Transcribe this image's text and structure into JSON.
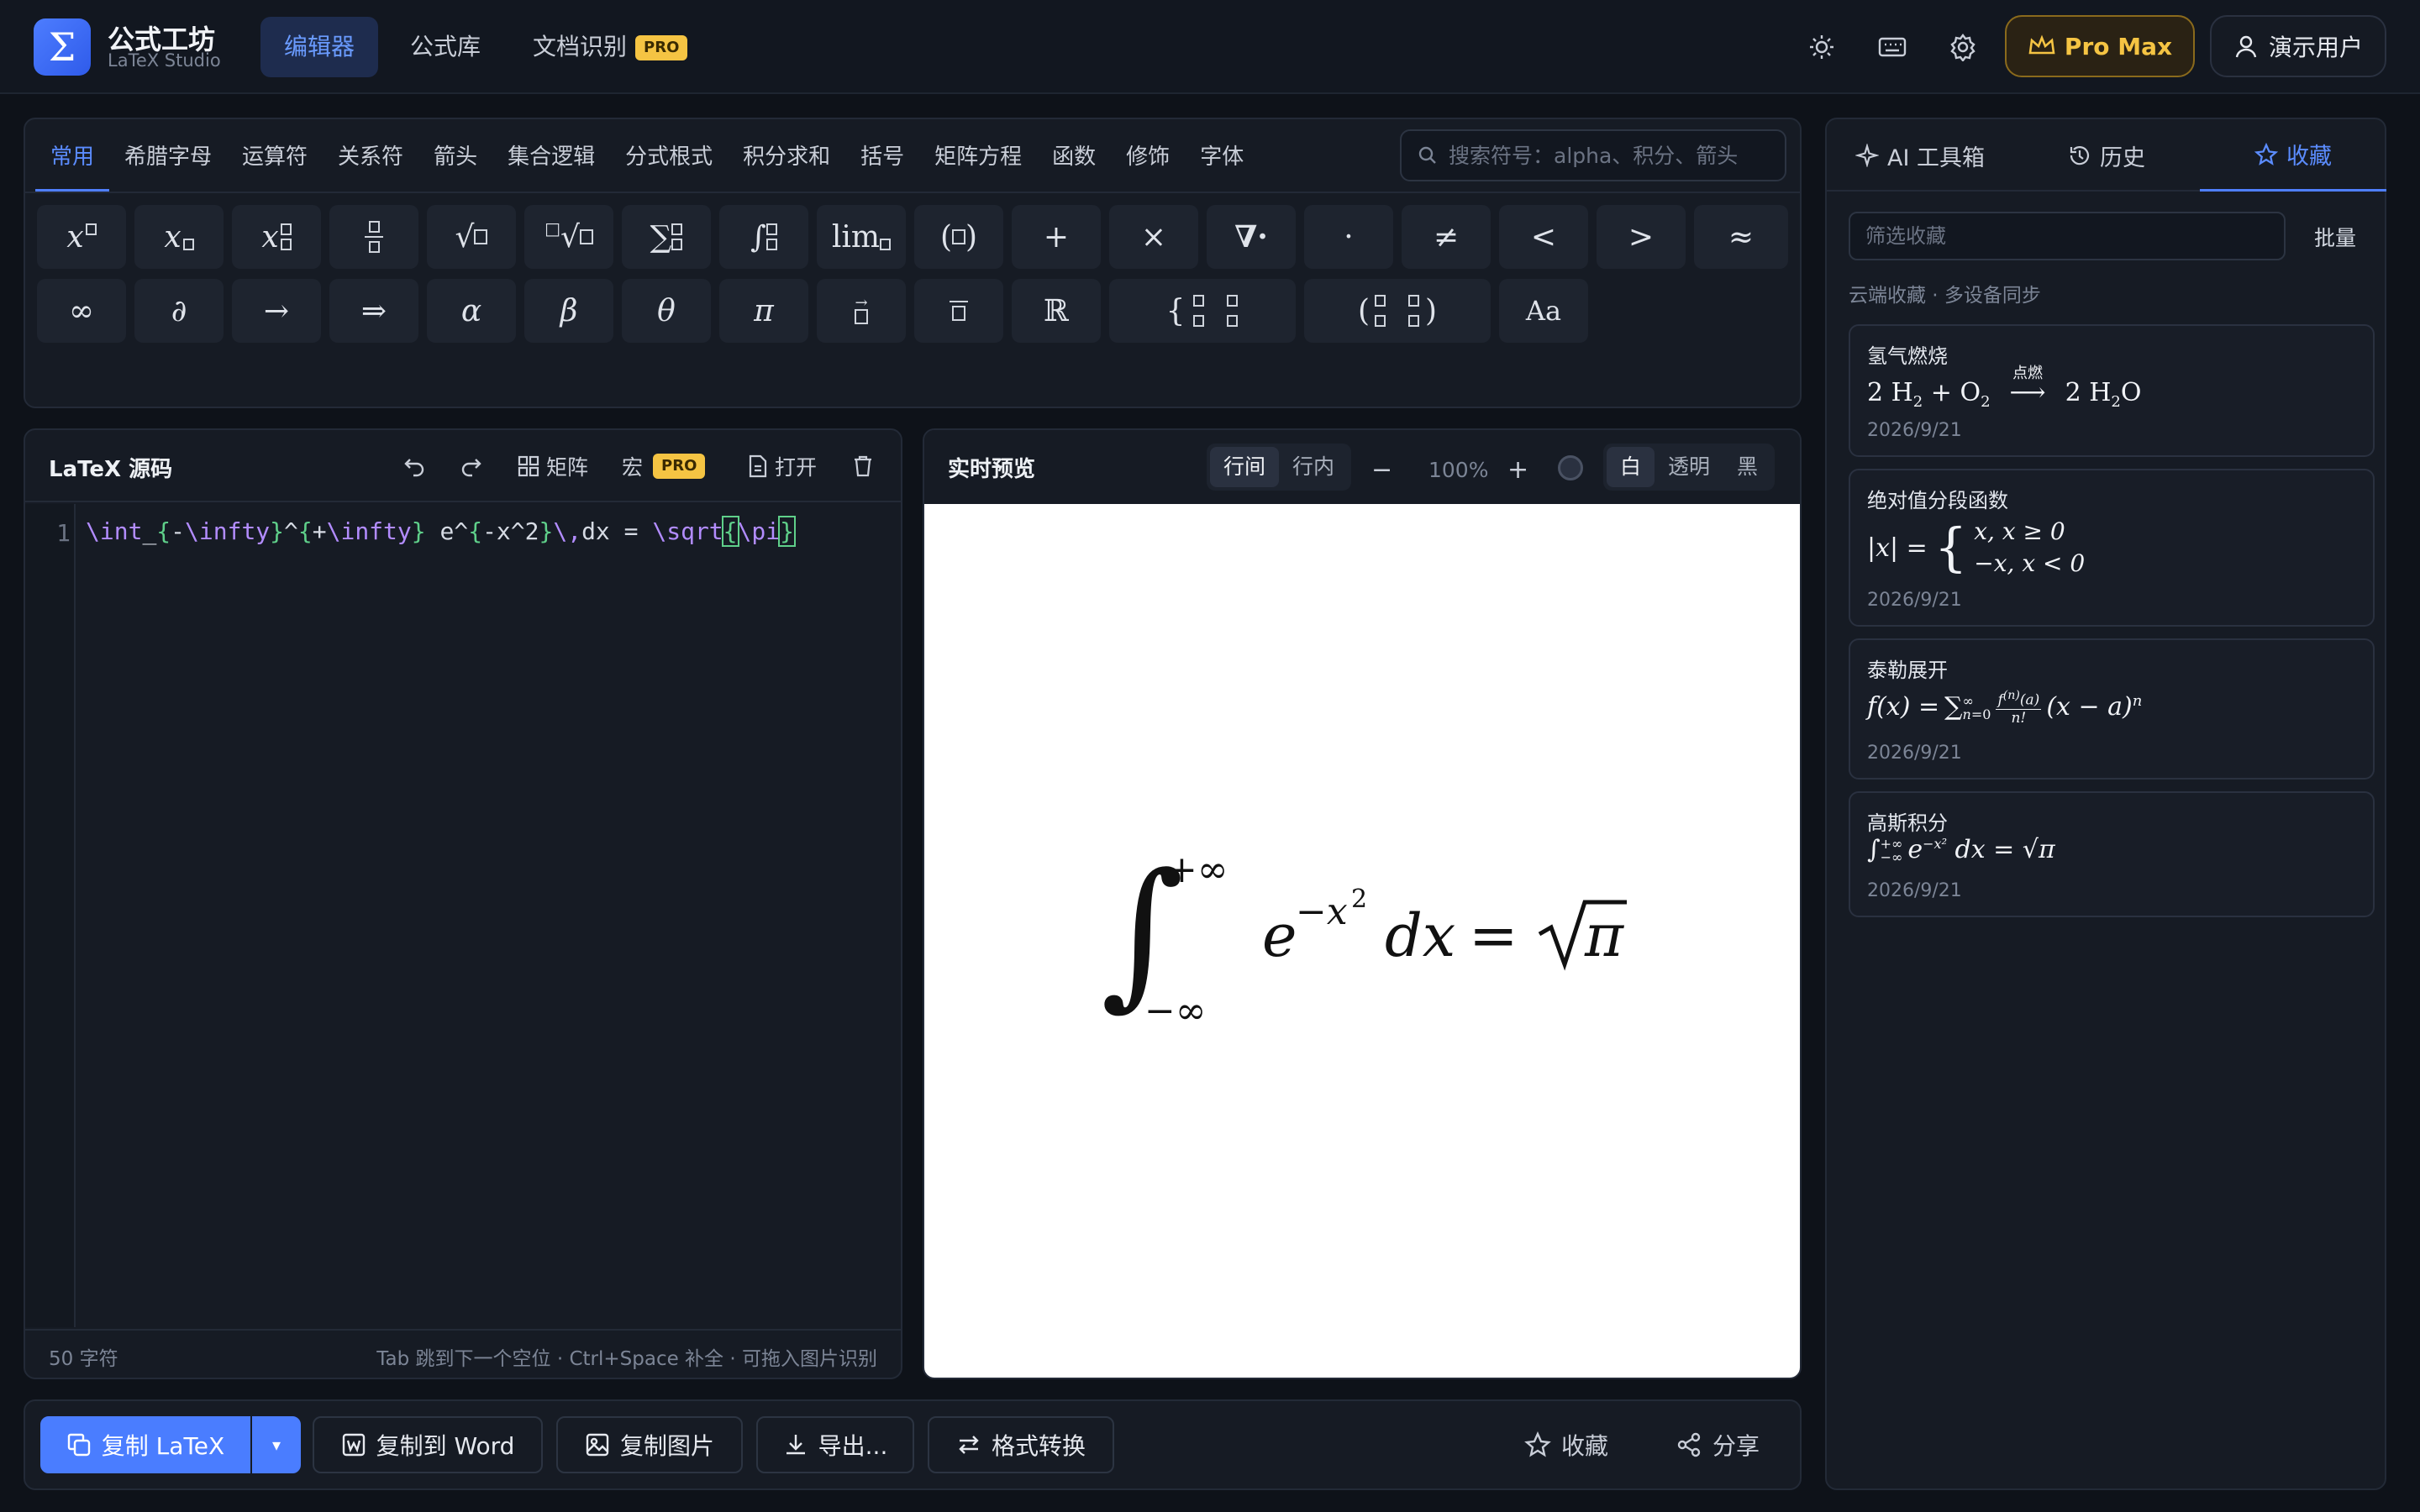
{
  "app": {
    "title": "公式工坊",
    "subtitle": "LaTeX Studio"
  },
  "nav": {
    "editor": "编辑器",
    "library": "公式库",
    "ocr": "文档识别",
    "ocr_badge": "PRO"
  },
  "header": {
    "plan": "Pro Max",
    "user": "演示用户",
    "icons": [
      "sun-icon",
      "keyboard-icon",
      "gear-icon",
      "crown-icon",
      "user-icon"
    ]
  },
  "palette": {
    "categories": [
      "常用",
      "希腊字母",
      "运算符",
      "关系符",
      "箭头",
      "集合逻辑",
      "分式根式",
      "积分求和",
      "括号",
      "矩阵方程",
      "函数",
      "修饰",
      "字体"
    ],
    "active_category": "常用",
    "search_placeholder": "搜索符号：alpha、积分、箭头",
    "symbols_row1": [
      "x□",
      "x□",
      "x□□",
      "□/□",
      "√□",
      "ⁿ√□",
      "∑□□",
      "∫□□",
      "lim□",
      "(□)",
      "+",
      "×",
      "∇·",
      "·",
      "≠",
      "<",
      ">",
      "≈"
    ],
    "symbols_row2": [
      "∞",
      "∂",
      "→",
      "⇒",
      "α",
      "β",
      "θ",
      "π",
      "→□",
      "‾□",
      "ℝ",
      "{cases}",
      "(matrix)",
      "Aa"
    ]
  },
  "source": {
    "title": "LaTeX 源码",
    "matrix": "矩阵",
    "macro": "宏",
    "macro_badge": "PRO",
    "open": "打开",
    "line_number": "1",
    "code": "\\int_{-\\infty}^{+\\infty} e^{-x^2}\\,dx = \\sqrt{\\pi}",
    "char_count": "50 字符",
    "hint": "Tab 跳到下一个空位 · Ctrl+Space 补全 · 可拖入图片识别"
  },
  "preview": {
    "title": "实时预览",
    "mode_display": "行间",
    "mode_inline": "行内",
    "zoom": "100%",
    "bg_white": "白",
    "bg_transparent": "透明",
    "bg_black": "黑",
    "formula": {
      "upper": "+∞",
      "lower": "−∞",
      "e": "e",
      "exp": "−x",
      "exp_pow": "2",
      "dx": "dx",
      "eq": "=",
      "pi": "π"
    }
  },
  "actions": {
    "copy_latex": "复制 LaTeX",
    "copy_word": "复制到 Word",
    "copy_image": "复制图片",
    "export": "导出...",
    "convert": "格式转换",
    "favorite": "收藏",
    "share": "分享"
  },
  "sidebar": {
    "tabs": [
      "AI 工具箱",
      "历史",
      "收藏"
    ],
    "active_tab": "收藏",
    "filter_placeholder": "筛选收藏",
    "batch": "批量",
    "cloud_note": "云端收藏 · 多设备同步",
    "favorites": [
      {
        "name": "氢气燃烧",
        "date": "2026/9/21",
        "formula": "2 H₂ + O₂ ⟶ 2 H₂O",
        "label": "点燃"
      },
      {
        "name": "绝对值分段函数",
        "date": "2026/9/21",
        "formula": "|x| = { x, x ≥ 0 ; −x, x < 0 }",
        "case1": "x,      x ≥ 0",
        "case2": "−x,   x < 0"
      },
      {
        "name": "泰勒展开",
        "date": "2026/9/21",
        "formula": "f(x) = ∑ f⁽ⁿ⁾(a)/n! (x − a)ⁿ"
      },
      {
        "name": "高斯积分",
        "date": "2026/9/21",
        "formula": "∫ e^(−x²) dx = √π"
      }
    ]
  },
  "colors": {
    "accent": "#4a7dff",
    "gold": "#f5c443",
    "code_keyword": "#b28cff",
    "code_brace": "#5fd08a",
    "bg": "#0e1219"
  }
}
